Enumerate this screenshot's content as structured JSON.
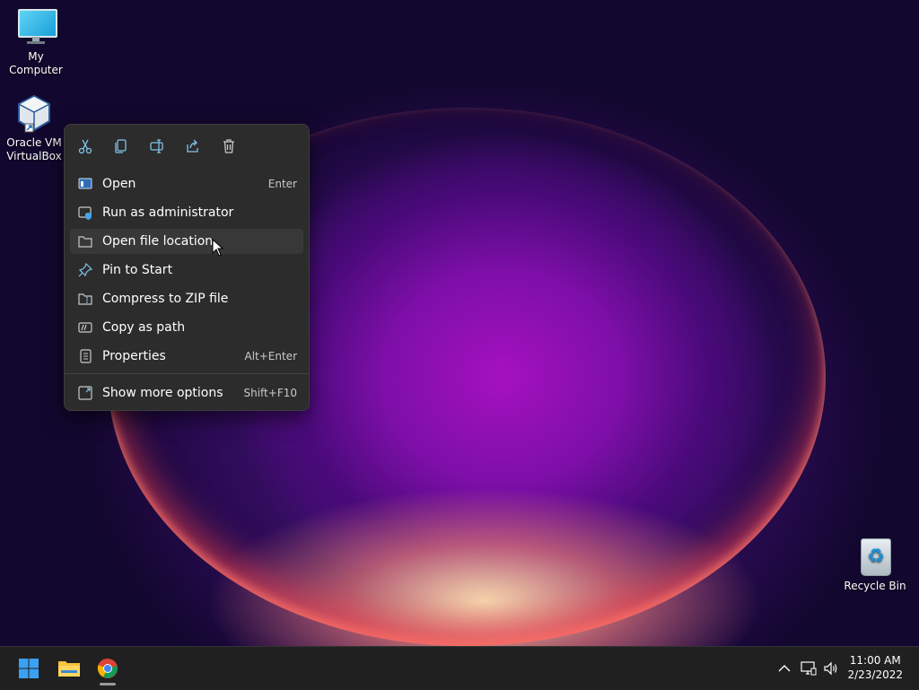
{
  "desktop": {
    "icons": [
      {
        "label": "My Computer",
        "icon": "monitor-icon"
      },
      {
        "label": "Oracle VM VirtualBox",
        "icon": "virtualbox-icon"
      },
      {
        "label": "Recycle Bin",
        "icon": "recycle-bin-icon"
      }
    ]
  },
  "context_menu": {
    "toolbar": [
      "cut-icon",
      "copy-icon",
      "rename-icon",
      "share-icon",
      "delete-icon"
    ],
    "items": [
      {
        "label": "Open",
        "shortcut": "Enter",
        "icon": "open-app-icon"
      },
      {
        "label": "Run as administrator",
        "shortcut": "",
        "icon": "shield-icon"
      },
      {
        "label": "Open file location",
        "shortcut": "",
        "icon": "folder-icon"
      },
      {
        "label": "Pin to Start",
        "shortcut": "",
        "icon": "pin-icon"
      },
      {
        "label": "Compress to ZIP file",
        "shortcut": "",
        "icon": "zip-folder-icon"
      },
      {
        "label": "Copy as path",
        "shortcut": "",
        "icon": "copy-path-icon"
      },
      {
        "label": "Properties",
        "shortcut": "Alt+Enter",
        "icon": "properties-icon"
      },
      {
        "label": "Show more options",
        "shortcut": "Shift+F10",
        "icon": "more-options-icon"
      }
    ],
    "hovered_item": "Open file location"
  },
  "taskbar": {
    "apps": [
      "start-icon",
      "file-explorer-icon",
      "chrome-icon"
    ],
    "tray": [
      "chevron-up-icon",
      "network-icon",
      "volume-icon"
    ],
    "time": "11:00 AM",
    "date": "2/23/2022"
  },
  "colors": {
    "menu_bg": "#2c2c2c",
    "menu_hover": "#383838",
    "taskbar_bg": "#202020",
    "accent": "#60cdff"
  }
}
